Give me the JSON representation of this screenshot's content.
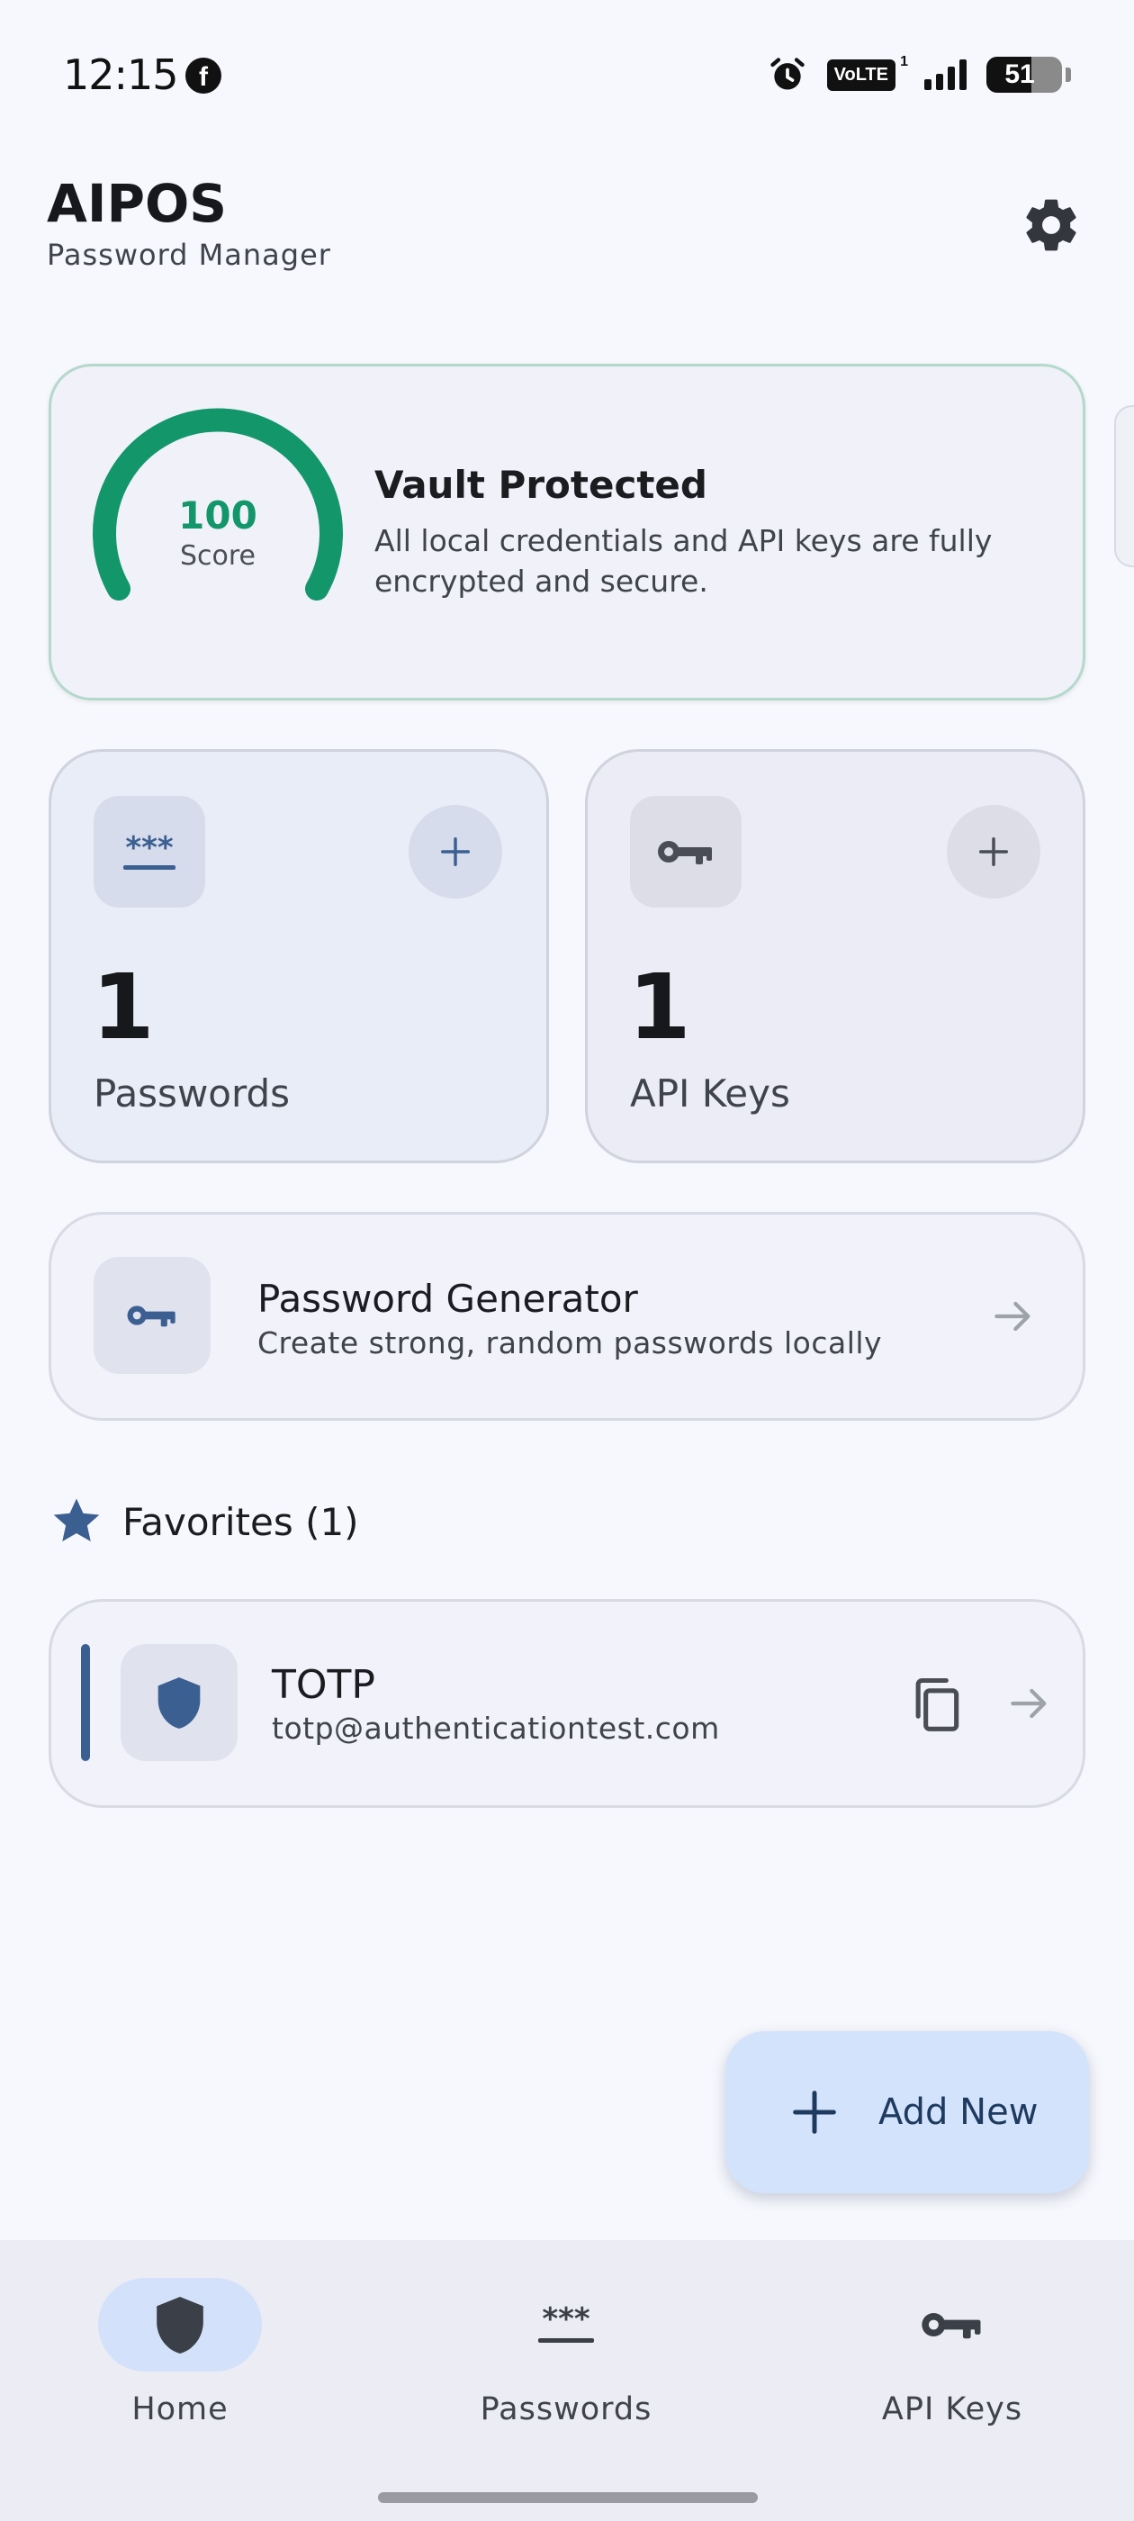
{
  "status_bar": {
    "time": "12:15",
    "volte_label": "VoLTE",
    "volte_sim": "1",
    "battery": "51",
    "icons": [
      "facebook-icon",
      "alarm-icon",
      "signal-icon",
      "battery-icon"
    ]
  },
  "header": {
    "title": "AIPOS",
    "subtitle": "Password Manager",
    "settings_icon": "gear-icon"
  },
  "security": {
    "score": "100",
    "score_label": "Score",
    "score_value": 100,
    "title": "Vault Protected",
    "description": "All local credentials and API keys are fully encrypted and secure.",
    "accent_color": "#12966a"
  },
  "stats": {
    "passwords": {
      "count": "1",
      "label": "Passwords",
      "icon": "password-icon",
      "add_icon": "plus-icon"
    },
    "api_keys": {
      "count": "1",
      "label": "API Keys",
      "icon": "key-icon",
      "add_icon": "plus-icon"
    }
  },
  "generator": {
    "title": "Password Generator",
    "subtitle": "Create strong, random passwords locally",
    "icon": "key-icon"
  },
  "favorites": {
    "title": "Favorites (1)",
    "items": [
      {
        "name": "TOTP",
        "email": "totp@authenticationtest.com",
        "icon": "shield-icon"
      }
    ]
  },
  "fab": {
    "label": "Add New",
    "icon": "plus-icon"
  },
  "nav": {
    "items": [
      {
        "label": "Home",
        "icon": "shield-icon",
        "active": true
      },
      {
        "label": "Passwords",
        "icon": "password-icon",
        "active": false
      },
      {
        "label": "API Keys",
        "icon": "key-icon",
        "active": false
      }
    ]
  },
  "colors": {
    "primary": "#3c5f92",
    "background": "#f7f8fd",
    "fab": "#d3e3fb",
    "success": "#12966a"
  }
}
